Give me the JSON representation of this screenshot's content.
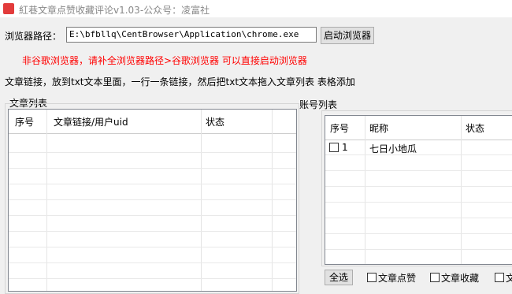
{
  "window": {
    "title": "紅巷文章点赞收藏评论v1.03-公众号：凌富社"
  },
  "browser": {
    "path_label": "浏览器路径：",
    "path_value": "E:\\bfbllq\\CentBrowser\\Application\\chrome.exe",
    "launch_button": "启动浏览器"
  },
  "warning": "非谷歌浏览器，请补全浏览器路径>谷歌浏览器 可以直接启动浏览器",
  "instructions": "文章链接，放到txt文本里面，一行一条链接，然后把txt文本拖入文章列表 表格添加",
  "articles": {
    "title": "文章列表",
    "columns": [
      "序号",
      "文章链接/用户uid",
      "状态"
    ]
  },
  "accounts": {
    "title": "账号列表",
    "columns": [
      "序号",
      "昵称",
      "状态"
    ],
    "rows": [
      {
        "index": "1",
        "nickname": "七日小地瓜"
      }
    ]
  },
  "actions": {
    "select_all": "全选",
    "like": "文章点赞",
    "favorite": "文章收藏",
    "comment": "文"
  }
}
